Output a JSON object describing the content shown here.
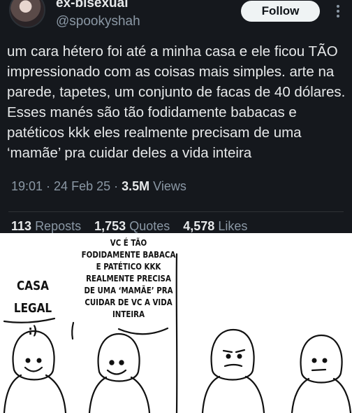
{
  "tweet": {
    "display_name": "ex-bisexual",
    "handle": "@spookyshah",
    "follow_label": "Follow",
    "text": "um cara hétero foi até a minha casa e ele ficou TÃO impressionado com as coisas mais simples. arte na parede, tapetes, um conjunto de facas de 40 dólares. Esses manés são tão fodidamente babacas e patéticos kkk eles realmente precisam de uma ‘mamãe’ pra cuidar deles a vida inteira",
    "time": "19:01",
    "date": "24 Feb 25",
    "views_count": "3.5M",
    "views_label": "Views",
    "reposts_count": "113",
    "reposts_label": "Reposts",
    "quotes_count": "1,753",
    "quotes_label": "Quotes",
    "likes_count": "4,578",
    "likes_label": "Likes"
  },
  "comic": {
    "speech_left": "CASA LEGAL :)",
    "speech_right": "VC É TÃO FODIDAMENTE BABACA E PATÉTICO KKK REALMENTE PRECISA DE UMA ‘MAMÃE’ PRA CUIDAR DE VC A VIDA INTEIRA"
  },
  "colors": {
    "tweet_bg": "#15181d",
    "text_primary": "#e7e9ea",
    "text_secondary": "#8b98a5",
    "follow_bg": "#eff3f4"
  }
}
